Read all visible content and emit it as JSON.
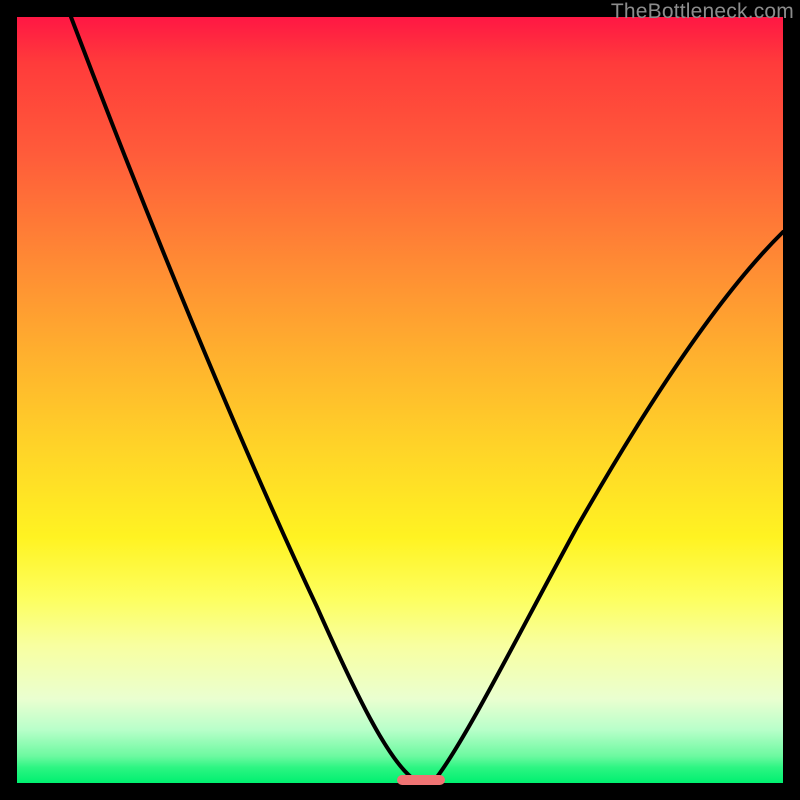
{
  "watermark": "TheBottleneck.com",
  "colors": {
    "curve": "#000000",
    "marker": "#ef7373",
    "background": "#000000"
  },
  "chart_data": {
    "type": "line",
    "title": "",
    "xlabel": "",
    "ylabel": "",
    "xlim": [
      0,
      100
    ],
    "ylim": [
      0,
      100
    ],
    "grid": false,
    "x": [
      0,
      5,
      10,
      15,
      20,
      25,
      30,
      35,
      40,
      45,
      48,
      50,
      52,
      54,
      56,
      60,
      65,
      70,
      75,
      80,
      85,
      90,
      95,
      100
    ],
    "series": [
      {
        "name": "bottleneck-curve",
        "values": [
          100,
          93,
          85,
          77,
          68,
          60,
          50,
          40,
          29,
          15,
          5,
          1,
          0,
          1,
          5,
          15,
          27,
          37,
          45,
          52,
          58,
          63,
          67,
          71
        ]
      }
    ],
    "marker": {
      "x_start": 49,
      "x_end": 54,
      "y": 0
    },
    "annotations": []
  }
}
